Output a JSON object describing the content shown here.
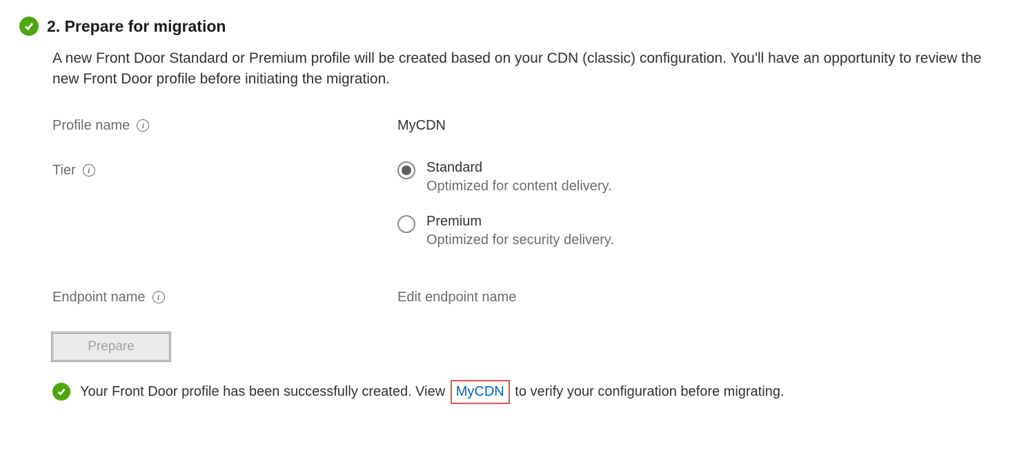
{
  "step": {
    "title": "2. Prepare for migration",
    "description": "A new Front Door Standard or Premium profile will be created based on your CDN (classic) configuration. You'll have an opportunity to review the new Front Door profile before initiating the migration."
  },
  "form": {
    "profileNameLabel": "Profile name",
    "profileNameValue": "MyCDN",
    "tierLabel": "Tier",
    "tierOptions": {
      "standard": {
        "label": "Standard",
        "sub": "Optimized for content delivery."
      },
      "premium": {
        "label": "Premium",
        "sub": "Optimized for security delivery."
      }
    },
    "endpointNameLabel": "Endpoint name",
    "endpointNameValue": "Edit endpoint name"
  },
  "actions": {
    "prepareLabel": "Prepare"
  },
  "status": {
    "textBefore": "Your Front Door profile has been successfully created. View ",
    "link": "MyCDN",
    "textAfter": " to verify your configuration before migrating."
  }
}
